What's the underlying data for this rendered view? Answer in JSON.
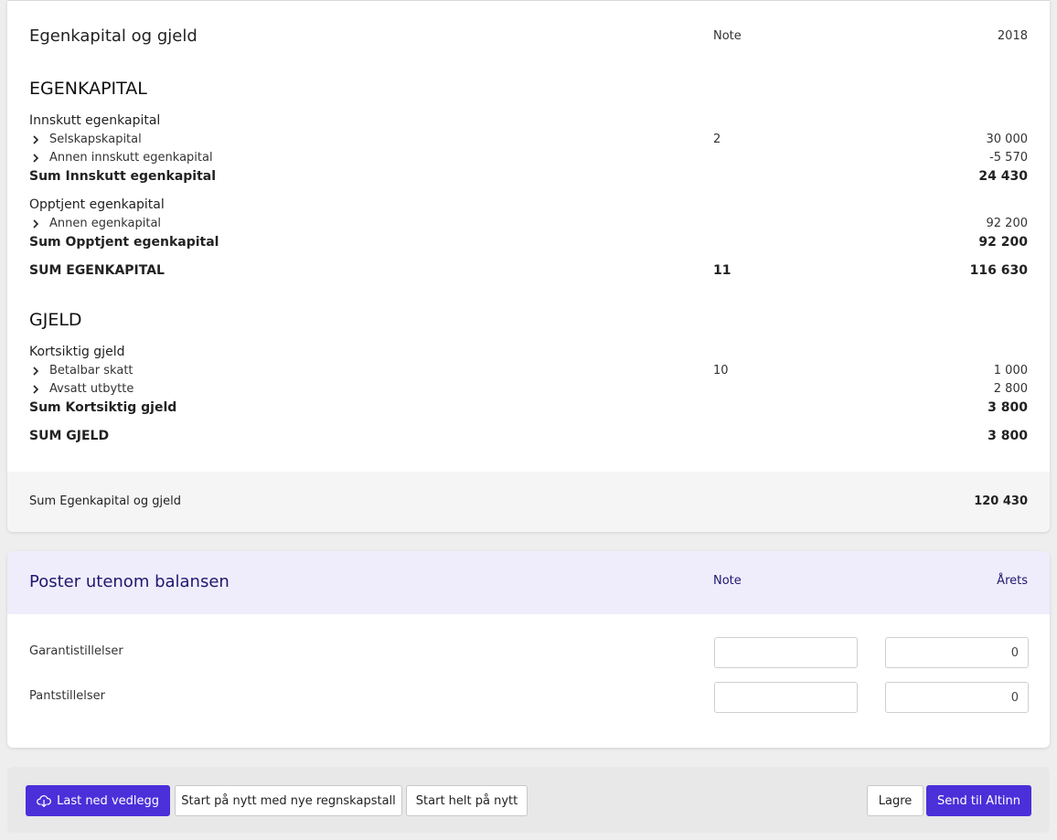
{
  "balance": {
    "title": "Egenkapital og gjeld",
    "note_header": "Note",
    "year_header": "2018",
    "equity": {
      "heading": "EGENKAPITAL",
      "paid_in": {
        "label": "Innskutt egenkapital",
        "items": [
          {
            "label": "Selskapskapital",
            "note": "2",
            "value": "30 000"
          },
          {
            "label": "Annen innskutt egenkapital",
            "note": "",
            "value": "-5 570"
          }
        ],
        "sum_label": "Sum Innskutt egenkapital",
        "sum_value": "24 430"
      },
      "earned": {
        "label": "Opptjent egenkapital",
        "items": [
          {
            "label": "Annen egenkapital",
            "note": "",
            "value": "92 200"
          }
        ],
        "sum_label": "Sum Opptjent egenkapital",
        "sum_value": "92 200"
      },
      "total_label": "SUM EGENKAPITAL",
      "total_note": "11",
      "total_value": "116 630"
    },
    "debt": {
      "heading": "GJELD",
      "short_term": {
        "label": "Kortsiktig gjeld",
        "items": [
          {
            "label": "Betalbar skatt",
            "note": "10",
            "value": "1 000"
          },
          {
            "label": "Avsatt utbytte",
            "note": "",
            "value": "2 800"
          }
        ],
        "sum_label": "Sum Kortsiktig gjeld",
        "sum_value": "3 800"
      },
      "total_label": "SUM GJELD",
      "total_value": "3 800"
    },
    "footer": {
      "label": "Sum Egenkapital og gjeld",
      "value": "120 430"
    }
  },
  "off_balance": {
    "title": "Poster utenom balansen",
    "note_header": "Note",
    "year_header": "Årets",
    "rows": [
      {
        "label": "Garantistillelser",
        "note_value": "",
        "year_value": "0"
      },
      {
        "label": "Pantstillelser",
        "note_value": "",
        "year_value": "0"
      }
    ]
  },
  "actions": {
    "download": "Last ned vedlegg",
    "restart_new_figures": "Start på nytt med nye regnskapstall",
    "restart_full": "Start helt på nytt",
    "save": "Lagre",
    "send": "Send til Altinn"
  },
  "colors": {
    "primary": "#4b2fd9",
    "header_tint": "#efedfb",
    "header_text": "#1f1770"
  }
}
